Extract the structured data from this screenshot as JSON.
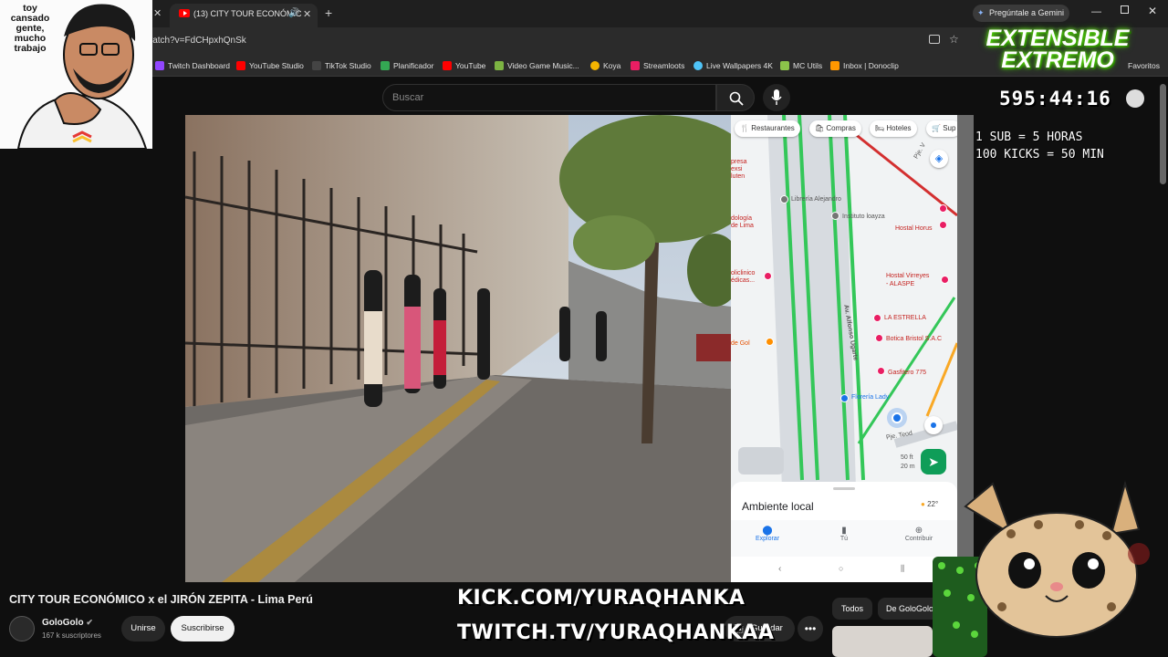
{
  "browser": {
    "active_tab_title": "(13) CITY TOUR ECONÓMIC",
    "url": "watch?v=FdCHpxhQnSk",
    "gemini_label": "Pregúntale a Gemini",
    "favorites_label": "Favoritos",
    "bookmarks": [
      {
        "label": "Twitch Dashboard",
        "color": "#9146ff"
      },
      {
        "label": "YouTube Studio",
        "color": "#ff0000"
      },
      {
        "label": "TikTok Studio",
        "color": "#222222"
      },
      {
        "label": "Planificador",
        "color": "#34a853"
      },
      {
        "label": "YouTube",
        "color": "#ff0000"
      },
      {
        "label": "Video Game Music...",
        "color": "#7cb342"
      },
      {
        "label": "Koya",
        "color": "#f4b400"
      },
      {
        "label": "Streamloots",
        "color": "#e91e63"
      },
      {
        "label": "Live Wallpapers 4K",
        "color": "#4fc3f7"
      },
      {
        "label": "MC Utils",
        "color": "#8bc34a"
      },
      {
        "label": "Inbox | Donoclip",
        "color": "#ff9800"
      }
    ]
  },
  "search": {
    "placeholder": "Buscar"
  },
  "map": {
    "chips": [
      "Restaurantes",
      "Compras",
      "Hoteles",
      "Sup"
    ],
    "labels": {
      "libreria": "Librería Alejandro",
      "instituto": "Instituto loayza",
      "hostal_horus": "Hostal Horus",
      "avenue": "Av. Alfonso Ugarte",
      "hostal_virreyes": "Hostal Virreyes\n- ALASPE",
      "estrella": "LA ESTRELLA",
      "botica": "Botica Bristol S.A.C",
      "gasfitero": "Gasfitero 775",
      "floreria": "Florería Lady",
      "pje": "Pje. Teod",
      "pje_top": "Pje. V",
      "left1": "presa\nexsi\nluten",
      "left2": "dología\nde Lima",
      "left3": "oliclinico\nédicas...",
      "left4": "de Gol",
      "scale_ft": "50 ft",
      "scale_m": "20 m"
    },
    "panel_title": "Ambiente local",
    "weather": "22°",
    "nav": [
      "Explorar",
      "Tú",
      "Contribuir"
    ]
  },
  "video": {
    "title": "CITY TOUR ECONÓMICO x el JIRÓN ZEPITA - Lima Perú",
    "channel": "GoloGolo",
    "subscribers": "167 k suscriptores",
    "join_label": "Unirse",
    "subscribe_label": "Suscribirse",
    "save_label": "Guardar"
  },
  "chips": [
    "Todos",
    "De GoloGolo"
  ],
  "overlay": {
    "webcam_text": "toy\ncansado\ngente,\nmucho\ntrabajo",
    "logo_line1": "EXTENSIBLE",
    "logo_line2": "EXTREMO",
    "timer": "595:44:16",
    "rule1": "1 SUB = 5 HORAS",
    "rule2": "100 KICKS = 50 MIN",
    "kick": "KICK.COM/YURAQHANKA",
    "twitch": "TWITCH.TV/YURAQHANKAA",
    "colors": {
      "kick": "#53fc18",
      "twitch": "#9146ff",
      "logo": "#6ef013"
    }
  }
}
